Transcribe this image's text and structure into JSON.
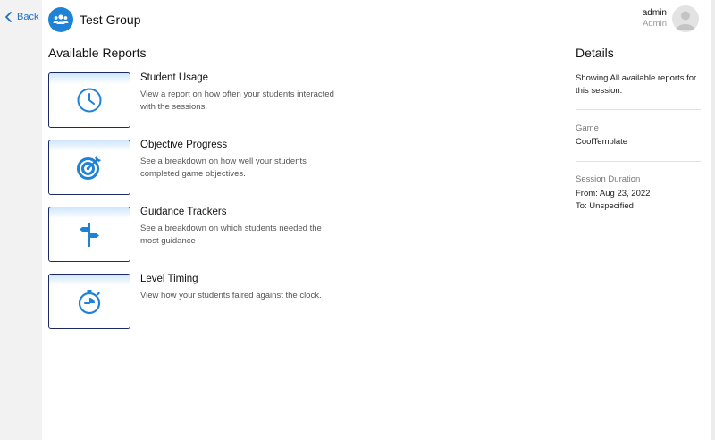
{
  "nav": {
    "back_label": "Back"
  },
  "header": {
    "group_name": "Test Group",
    "group_icon": "users-icon",
    "user_name": "admin",
    "user_role": "Admin",
    "user_icon": "avatar-placeholder-icon"
  },
  "reports": {
    "section_title": "Available Reports",
    "items": [
      {
        "title": "Student Usage",
        "description": "View a report on how often your students interacted with the sessions.",
        "icon": "clock-icon"
      },
      {
        "title": "Objective Progress",
        "description": "See a breakdown on how well your students completed game objectives.",
        "icon": "target-icon"
      },
      {
        "title": "Guidance Trackers",
        "description": "See a breakdown on which students needed the most guidance",
        "icon": "signpost-icon"
      },
      {
        "title": "Level Timing",
        "description": "View how your students faired against the clock.",
        "icon": "stopwatch-icon"
      }
    ]
  },
  "details": {
    "title": "Details",
    "summary": "Showing All available reports for this session.",
    "game_label": "Game",
    "game_value": "CoolTemplate",
    "duration_label": "Session Duration",
    "from_text": "From: Aug 23, 2022",
    "to_text": "To: Unspecified"
  },
  "colors": {
    "accent": "#1e83d6",
    "card_border": "#1a2a66",
    "link": "#1d6fc4"
  }
}
